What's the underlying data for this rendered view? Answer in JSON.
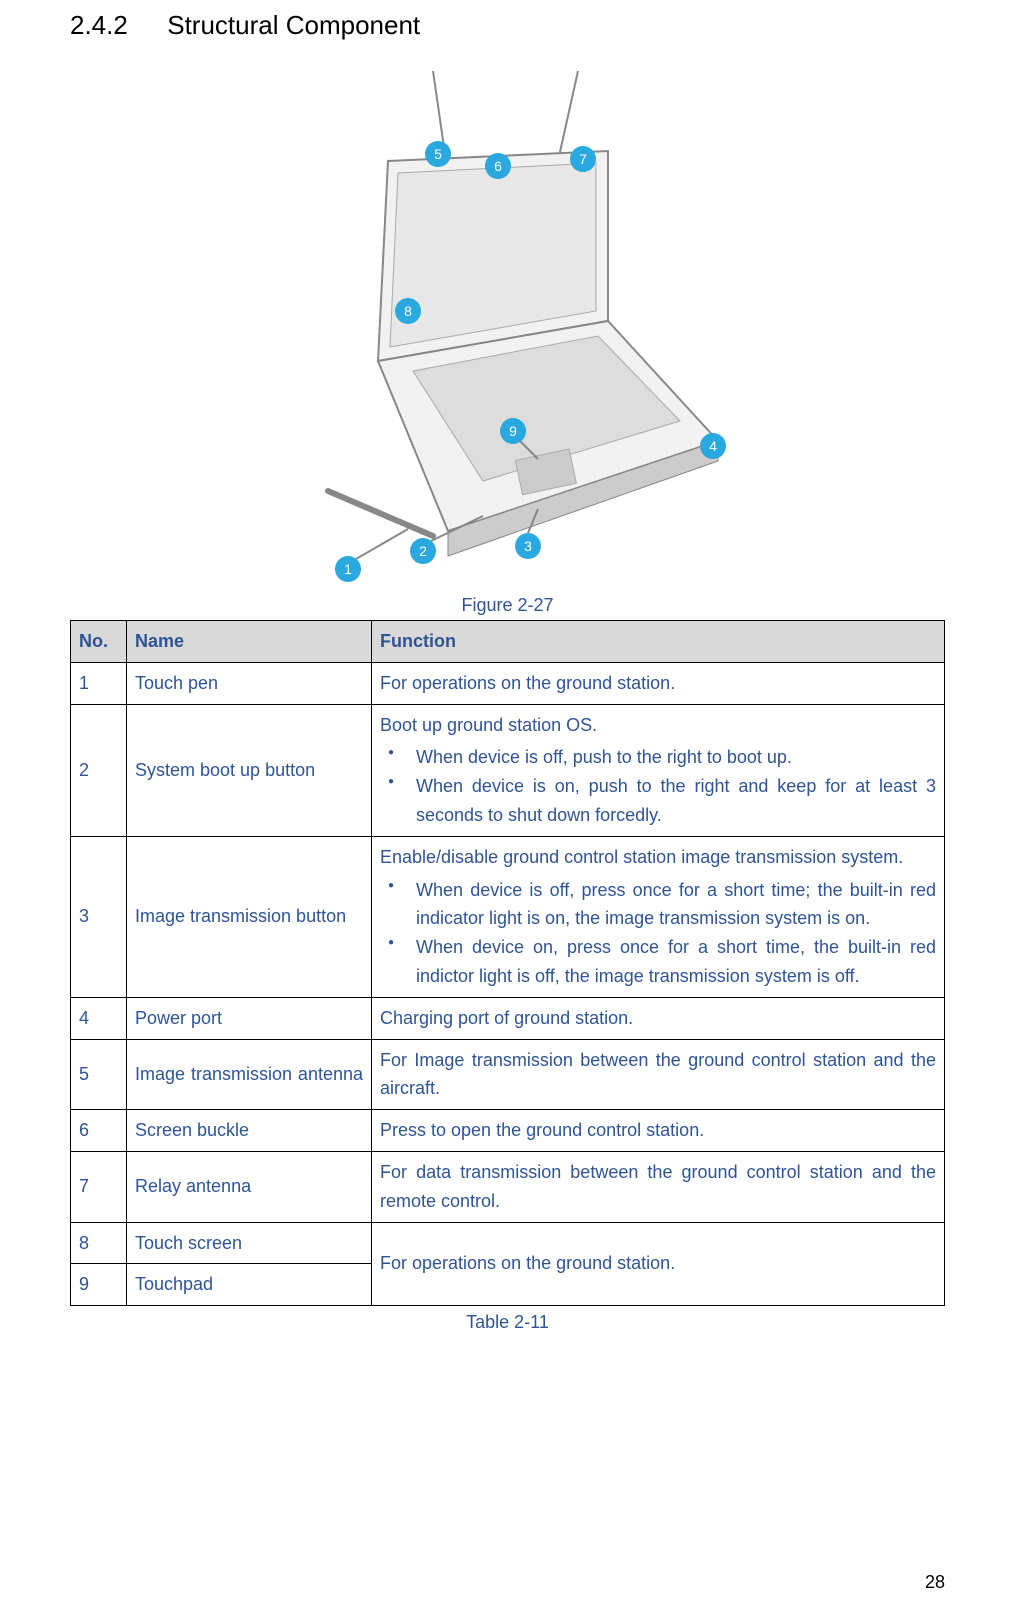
{
  "heading": {
    "number": "2.4.2",
    "title": "Structural Component"
  },
  "figure": {
    "caption": "Figure 2-27",
    "callouts": {
      "c1": "1",
      "c2": "2",
      "c3": "3",
      "c4": "4",
      "c5": "5",
      "c6": "6",
      "c7": "7",
      "c8": "8",
      "c9": "9"
    }
  },
  "table": {
    "headers": {
      "no": "No.",
      "name": "Name",
      "function": "Function"
    },
    "caption": "Table 2-11",
    "rows": {
      "r1": {
        "no": "1",
        "name": "Touch pen",
        "func": "For operations on the ground station."
      },
      "r2": {
        "no": "2",
        "name": "System boot up button",
        "intro": "Boot up ground station OS.",
        "b1": "When device is off, push to the right to boot up.",
        "b2": "When device is on, push to the right and keep for at least 3 seconds to shut down forcedly."
      },
      "r3": {
        "no": "3",
        "name": "Image transmission button",
        "intro": "Enable/disable ground control station image transmission system.",
        "b1": "When device is off, press once for a short time; the built-in red indicator light is on, the image transmission system is on.",
        "b2": "When device on, press once for a short time, the built-in red indictor light is off, the image transmission system is off."
      },
      "r4": {
        "no": "4",
        "name": "Power port",
        "func": "Charging port of ground station."
      },
      "r5": {
        "no": "5",
        "name": "Image transmission antenna",
        "func": "For Image transmission between the ground control station and the aircraft."
      },
      "r6": {
        "no": "6",
        "name": "Screen buckle",
        "func": "Press to open the ground control station."
      },
      "r7": {
        "no": "7",
        "name": "Relay antenna",
        "func": "For data transmission between the ground control station and the remote control."
      },
      "r8": {
        "no": "8",
        "name": "Touch screen"
      },
      "r9": {
        "no": "9",
        "name": "Touchpad"
      },
      "r89func": "For operations on the ground station."
    }
  },
  "pageNumber": "28"
}
